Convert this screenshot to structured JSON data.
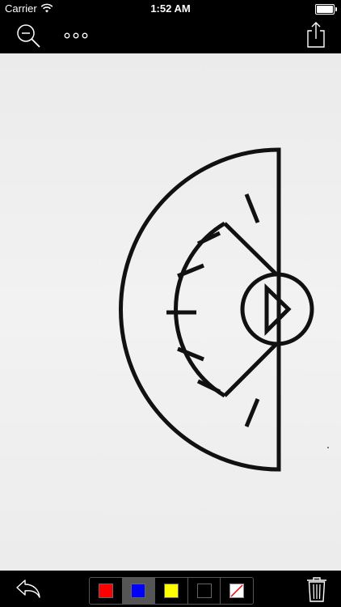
{
  "status_bar": {
    "carrier": "Carrier",
    "time": "1:52 AM"
  },
  "toolbar": {
    "zoom_icon": "zoom-out-icon",
    "more_icon": "more-dots-icon",
    "share_icon": "share-icon"
  },
  "palette": {
    "colors": [
      {
        "name": "red",
        "hex": "#ff0000"
      },
      {
        "name": "blue",
        "hex": "#0000ff"
      },
      {
        "name": "yellow",
        "hex": "#ffff00"
      },
      {
        "name": "black",
        "hex": "#000000"
      },
      {
        "name": "none",
        "hex": ""
      }
    ],
    "selected_index": 1
  },
  "bottom_toolbar": {
    "undo_icon": "undo-icon",
    "trash_icon": "trash-icon"
  }
}
